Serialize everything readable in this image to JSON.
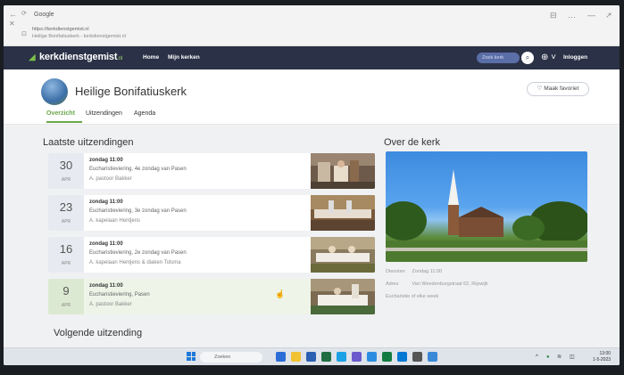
{
  "browser": {
    "tab_title": "Google",
    "url_line1": "https://kerkdienstgemist.nl",
    "url_line2": "Heilige Bonifatiuskerk - kerkdienstgemist.nl",
    "window_controls": [
      "⊟",
      "…",
      "—",
      "↗"
    ]
  },
  "nav": {
    "logo_text": "kerkdienstgemist",
    "logo_suffix": ".nl",
    "links": [
      "Home",
      "Mijn kerken"
    ],
    "search_placeholder": "Zoek kerk",
    "login_label": "Inloggen"
  },
  "church": {
    "name": "Heilige Bonifatiuskerk",
    "favorite_label": "Maak favoriet",
    "tabs": [
      "Overzicht",
      "Uitzendingen",
      "Agenda"
    ]
  },
  "latest": {
    "heading": "Laatste uitzendingen",
    "items": [
      {
        "day": "30",
        "month": "APR",
        "time": "zondag 11:00",
        "title": "Eucharistieviering, 4e zondag van Pasen",
        "preacher": "A. pastoor Bakker"
      },
      {
        "day": "23",
        "month": "APR",
        "time": "zondag 11:00",
        "title": "Eucharistieviering, 3e zondag van Pasen",
        "preacher": "A. kapelaan Hentjens"
      },
      {
        "day": "16",
        "month": "APR",
        "time": "zondag 11:00",
        "title": "Eucharistieviering, 2e zondag van Pasen",
        "preacher": "A. kapelaan Hentjens & diaken Tolsma"
      },
      {
        "day": "9",
        "month": "APR",
        "time": "zondag 11:00",
        "title": "Eucharistieviering, Pasen",
        "preacher": "A. pastoor Bakker"
      }
    ]
  },
  "about": {
    "heading": "Over de kerk",
    "service_label": "Diensten",
    "service_value": "Zondag 11:00",
    "address_label": "Adres",
    "address_value": "Van Weedenburgstraat 62, Rijswijk",
    "extra": "Eucharistie of elke week"
  },
  "next": {
    "heading": "Volgende uitzending"
  },
  "taskbar": {
    "search_label": "Zoeken",
    "clock_time": "13:00",
    "clock_date": "1-5-2023"
  }
}
